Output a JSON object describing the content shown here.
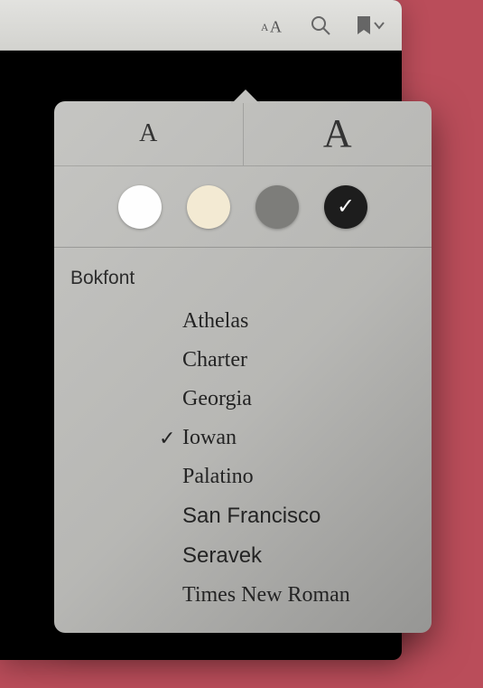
{
  "toolbar": {
    "appearance_icon": "aA",
    "search_icon": "search",
    "bookmark_icon": "bookmark"
  },
  "popover": {
    "size_small": "A",
    "size_large": "A",
    "themes": {
      "white": {
        "selected": false,
        "color": "#fefefe"
      },
      "sepia": {
        "selected": false,
        "color": "#f3ead3"
      },
      "gray": {
        "selected": false,
        "color": "#7d7d7a"
      },
      "black": {
        "selected": true,
        "color": "#1d1d1d"
      }
    },
    "font_heading": "Bokfont",
    "fonts": [
      {
        "name": "Athelas",
        "selected": false,
        "family_class": "f-athelas"
      },
      {
        "name": "Charter",
        "selected": false,
        "family_class": "f-charter"
      },
      {
        "name": "Georgia",
        "selected": false,
        "family_class": "f-georgia"
      },
      {
        "name": "Iowan",
        "selected": true,
        "family_class": "f-iowan"
      },
      {
        "name": "Palatino",
        "selected": false,
        "family_class": "f-palatino"
      },
      {
        "name": "San Francisco",
        "selected": false,
        "family_class": "f-sf"
      },
      {
        "name": "Seravek",
        "selected": false,
        "family_class": "f-seravek"
      },
      {
        "name": "Times New Roman",
        "selected": false,
        "family_class": "f-tnr"
      }
    ]
  }
}
